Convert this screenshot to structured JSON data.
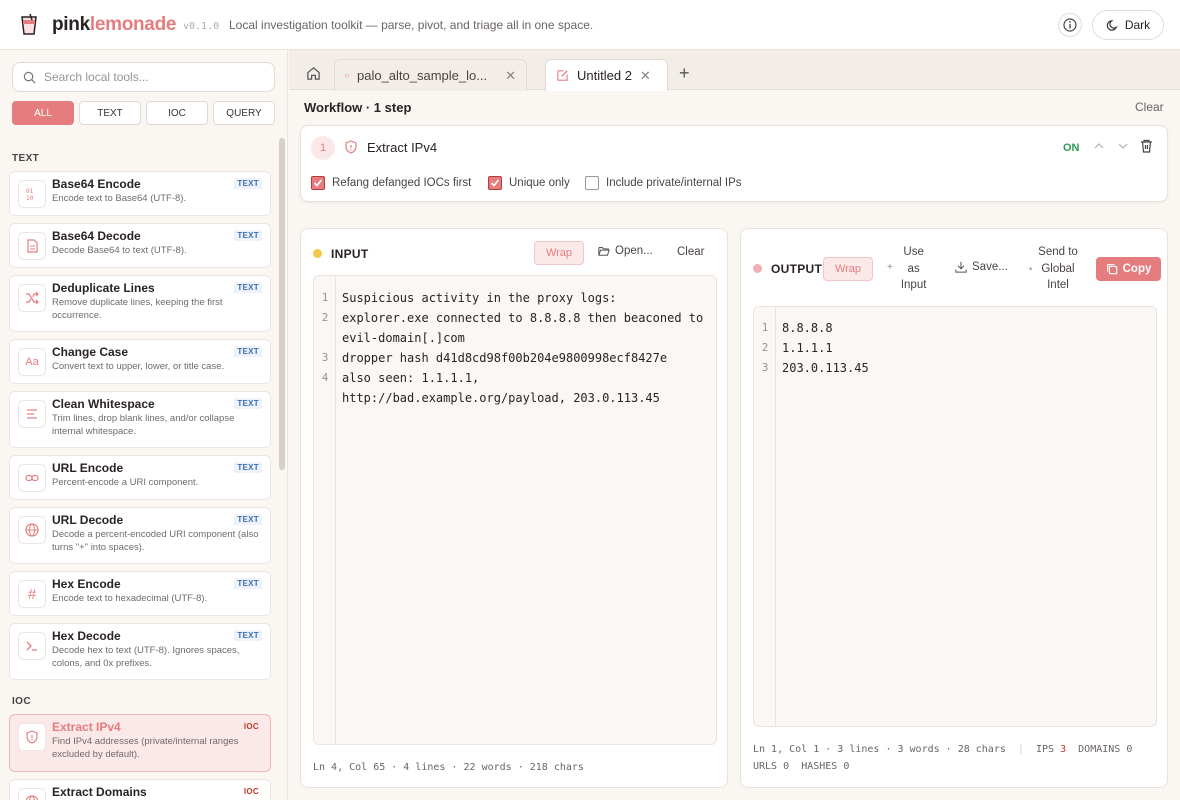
{
  "header": {
    "brand_part1": "pink",
    "brand_part2": "lemonade",
    "version": "v0.1.0",
    "tagline": "Local investigation toolkit — parse, pivot, and triage all in one space.",
    "theme_label": "Dark"
  },
  "sidebar": {
    "search_placeholder": "Search local tools...",
    "filters": [
      "ALL",
      "TEXT",
      "IOC",
      "QUERY"
    ],
    "sections": {
      "text": "TEXT",
      "ioc": "IOC"
    },
    "tools": [
      {
        "name": "Base64 Encode",
        "desc": "Encode text to Base64 (UTF-8).",
        "badge": "TEXT",
        "icon": "binary-icon"
      },
      {
        "name": "Base64 Decode",
        "desc": "Decode Base64 to text (UTF-8).",
        "badge": "TEXT",
        "icon": "file-text-icon"
      },
      {
        "name": "Deduplicate Lines",
        "desc": "Remove duplicate lines, keeping the first occurrence.",
        "badge": "TEXT",
        "icon": "shuffle-icon"
      },
      {
        "name": "Change Case",
        "desc": "Convert text to upper, lower, or title case.",
        "badge": "TEXT",
        "icon": "case-icon"
      },
      {
        "name": "Clean Whitespace",
        "desc": "Trim lines, drop blank lines, and/or collapse internal whitespace.",
        "badge": "TEXT",
        "icon": "align-left-icon"
      },
      {
        "name": "URL Encode",
        "desc": "Percent-encode a URI component.",
        "badge": "TEXT",
        "icon": "link-icon"
      },
      {
        "name": "URL Decode",
        "desc": "Decode a percent-encoded URI component (also turns \"+\" into spaces).",
        "badge": "TEXT",
        "icon": "globe-icon"
      },
      {
        "name": "Hex Encode",
        "desc": "Encode text to hexadecimal (UTF-8).",
        "badge": "TEXT",
        "icon": "hash-icon"
      },
      {
        "name": "Hex Decode",
        "desc": "Decode hex to text (UTF-8). Ignores spaces, colons, and 0x prefixes.",
        "badge": "TEXT",
        "icon": "terminal-icon"
      },
      {
        "name": "Extract IPv4",
        "desc": "Find IPv4 addresses (private/internal ranges excluded by default).",
        "badge": "IOC",
        "icon": "shield-icon"
      },
      {
        "name": "Extract Domains",
        "desc": "",
        "badge": "IOC",
        "icon": "globe-icon"
      }
    ]
  },
  "tabs": [
    {
      "label": "palo_alto_sample_lo...",
      "icon": "folder-icon"
    },
    {
      "label": "Untitled 2",
      "icon": "edit-icon"
    }
  ],
  "workflow": {
    "title": "Workflow · 1 step",
    "clear_label": "Clear",
    "step": {
      "number": "1",
      "name": "Extract IPv4",
      "state": "ON",
      "options": [
        {
          "label": "Refang defanged IOCs first",
          "checked": true
        },
        {
          "label": "Unique only",
          "checked": true
        },
        {
          "label": "Include private/internal IPs",
          "checked": false
        }
      ]
    }
  },
  "input": {
    "title": "INPUT",
    "wrap": "Wrap",
    "open": "Open...",
    "clear": "Clear",
    "lines": [
      {
        "n": "1",
        "text": "Suspicious activity in the proxy logs:"
      },
      {
        "n": "2",
        "text": "explorer.exe connected to 8.8.8.8 then beaconed to"
      },
      {
        "n": "",
        "text": "evil-domain[.]com"
      },
      {
        "n": "3",
        "text": "dropper hash d41d8cd98f00b204e9800998ecf8427e"
      },
      {
        "n": "4",
        "text": "also seen: 1.1.1.1,"
      },
      {
        "n": "",
        "text": "http://bad.example.org/payload, 203.0.113.45"
      }
    ],
    "status": "Ln 4, Col 65 · 4 lines · 22 words · 218 chars"
  },
  "output": {
    "title": "OUTPUT",
    "wrap": "Wrap",
    "use_as_input": [
      "Use",
      "as",
      "Input"
    ],
    "save": "Save...",
    "send": [
      "Send to",
      "Global",
      "Intel"
    ],
    "copy": "Copy",
    "lines": [
      {
        "n": "1",
        "text": "8.8.8.8"
      },
      {
        "n": "2",
        "text": "1.1.1.1"
      },
      {
        "n": "3",
        "text": "203.0.113.45"
      }
    ],
    "status": "Ln 1, Col 1 · 3 lines · 3 words · 28 chars",
    "ips_label": "IPS",
    "ips_count": "3",
    "domains_label": "DOMAINS",
    "domains_count": "0",
    "urls_label": "URLS",
    "urls_count": "0",
    "hashes_label": "HASHES",
    "hashes_count": "0"
  },
  "colors": {
    "accent": "#e57d7f",
    "on": "#2e9b53",
    "badge_text": "#3b6fb5",
    "badge_ioc": "#c0392b"
  }
}
